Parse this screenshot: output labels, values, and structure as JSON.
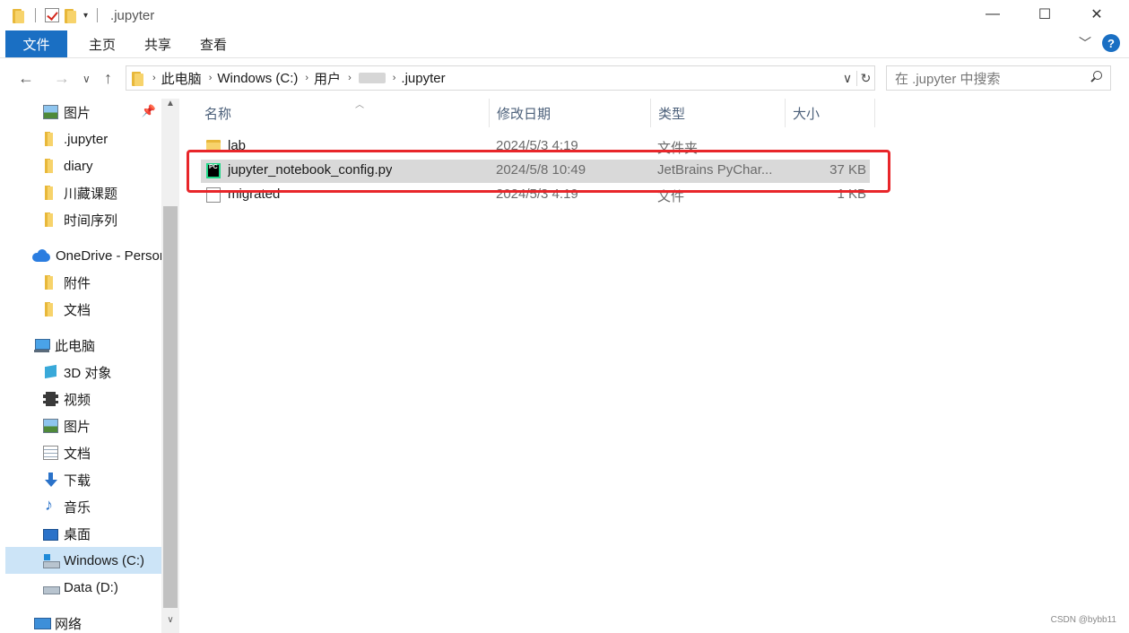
{
  "window": {
    "title": ".jupyter",
    "minimize_label": "—",
    "maximize_label": "☐",
    "close_label": "✕"
  },
  "ribbon": {
    "tabs": [
      "文件",
      "主页",
      "共享",
      "查看"
    ]
  },
  "address": {
    "crumbs": [
      "此电脑",
      "Windows (C:)",
      "用户",
      ".jupyter"
    ],
    "search_placeholder": "在 .jupyter 中搜索"
  },
  "sidebar": {
    "items": [
      {
        "label": "图片",
        "icon": "picture-icon",
        "pinned": true
      },
      {
        "label": ".jupyter",
        "icon": "folder-icon"
      },
      {
        "label": "diary",
        "icon": "folder-icon"
      },
      {
        "label": "川藏课题",
        "icon": "folder-icon"
      },
      {
        "label": "时间序列",
        "icon": "folder-icon"
      },
      {
        "label": "OneDrive - Personal",
        "icon": "onedrive-icon"
      },
      {
        "label": "附件",
        "icon": "folder-icon"
      },
      {
        "label": "文档",
        "icon": "folder-icon"
      },
      {
        "label": "此电脑",
        "icon": "this-pc-icon"
      },
      {
        "label": "3D 对象",
        "icon": "3d-objects-icon"
      },
      {
        "label": "视频",
        "icon": "video-icon"
      },
      {
        "label": "图片",
        "icon": "picture-icon"
      },
      {
        "label": "文档",
        "icon": "document-icon"
      },
      {
        "label": "下载",
        "icon": "download-icon"
      },
      {
        "label": "音乐",
        "icon": "music-icon"
      },
      {
        "label": "桌面",
        "icon": "desktop-icon"
      },
      {
        "label": "Windows (C:)",
        "icon": "drive-c-icon",
        "selected": true
      },
      {
        "label": "Data (D:)",
        "icon": "drive-icon"
      },
      {
        "label": "网络",
        "icon": "network-icon"
      }
    ]
  },
  "columns": [
    "名称",
    "修改日期",
    "类型",
    "大小"
  ],
  "files": [
    {
      "name": "lab",
      "modified": "2024/5/3 4:19",
      "type": "文件夹",
      "size": "",
      "icon": "folder-icon"
    },
    {
      "name": "jupyter_notebook_config.py",
      "modified": "2024/5/8 10:49",
      "type": "JetBrains PyChar...",
      "size": "37 KB",
      "icon": "pycharm-file-icon",
      "highlighted": true
    },
    {
      "name": "migrated",
      "modified": "2024/5/3 4:19",
      "type": "文件",
      "size": "1 KB",
      "icon": "file-icon"
    }
  ],
  "watermark": "CSDN @bybb11",
  "colors": {
    "accent": "#1a6fc3",
    "highlight_box": "#e8262a",
    "selected_row": "#d9d9d9"
  }
}
